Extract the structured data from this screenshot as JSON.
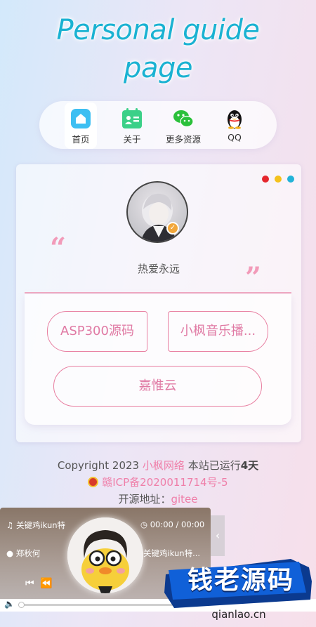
{
  "header": {
    "title": "Personal guide page"
  },
  "nav": {
    "items": [
      {
        "label": "首页",
        "icon": "home-icon",
        "color": "#3dbff2"
      },
      {
        "label": "关于",
        "icon": "id-card-icon",
        "color": "#3bd088"
      },
      {
        "label": "更多资源",
        "icon": "wechat-icon",
        "color": "#2bc03b"
      },
      {
        "label": "QQ",
        "icon": "qq-penguin-icon",
        "color": "#111111"
      }
    ]
  },
  "card": {
    "dots": [
      "#e5262d",
      "#f4c21c",
      "#22b3d8"
    ],
    "motto": "热爱永远",
    "quote_open": "“",
    "quote_close": "”",
    "links": [
      {
        "label": "ASP300源码"
      },
      {
        "label": "小枫音乐播..."
      },
      {
        "label": "嘉惟云"
      }
    ]
  },
  "footer": {
    "copyright_prefix": "Copyright 2023",
    "site_name": "小枫网络",
    "running_prefix": "本站已运行",
    "running_days": "4天",
    "icp": "赣ICP备2020011714号-5",
    "open_source_label": "开源地址：",
    "open_source_link": "gitee"
  },
  "player": {
    "track_title": "关键鸡ikun特",
    "time": "00:00 / 00:00",
    "artist": "郑秋何",
    "lyric": "关键鸡ikun特...",
    "arrow": "‹"
  },
  "watermark": {
    "brand": "钱老源码",
    "domain": "qianlao.cn"
  }
}
